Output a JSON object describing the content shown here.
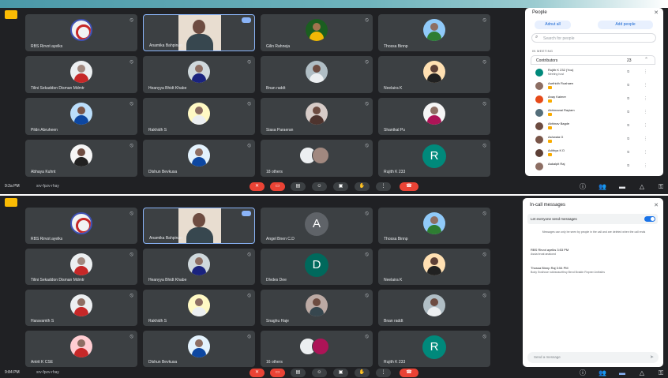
{
  "top": {
    "tiles": [
      {
        "name": "RBS Rirvot ayelks",
        "kind": "seal"
      },
      {
        "name": "Anamika Bahpinan",
        "kind": "video",
        "active": true
      },
      {
        "name": "Gilin Rahneja",
        "kind": "avatar",
        "skin": "#a1744e",
        "shirt": "#f2b705",
        "bg": "#1b5e20"
      },
      {
        "name": "Thossa Binnp",
        "kind": "avatar",
        "skin": "#8d6e63",
        "shirt": "#2e7d32",
        "bg": "#90caf9"
      },
      {
        "name": "Tilini Sekaddon Disman Mdmtr",
        "kind": "avatar",
        "skin": "#a1887f",
        "shirt": "#c62828",
        "bg": "#eceff1"
      },
      {
        "name": "Heanyya Bhidt Khabe",
        "kind": "avatar",
        "skin": "#8d6e63",
        "shirt": "#1a237e",
        "bg": "#cfd8dc"
      },
      {
        "name": "Bnan raddt",
        "kind": "avatar",
        "skin": "#6d4c41",
        "shirt": "#eceff1",
        "bg": "#b0bec5"
      },
      {
        "name": "Neelaira K",
        "kind": "avatar",
        "skin": "#5d4037",
        "shirt": "#212121",
        "bg": "#ffe0b2"
      },
      {
        "name": "Pildn Abruheen",
        "kind": "avatar",
        "skin": "#795548",
        "shirt": "#0d47a1",
        "bg": "#bbdefb"
      },
      {
        "name": "Rakhidh S",
        "kind": "avatar",
        "skin": "#8d6e63",
        "shirt": "#eceff1",
        "bg": "#fff9c4"
      },
      {
        "name": "Siasa Paraeran",
        "kind": "avatar",
        "skin": "#6d4c41",
        "shirt": "#4e342e",
        "bg": "#d7ccc8"
      },
      {
        "name": "Shantkal Pu",
        "kind": "avatar",
        "skin": "#8d6e63",
        "shirt": "#ad1457",
        "bg": "#f5f5f5"
      },
      {
        "name": "Abhaya Kuhnt",
        "kind": "avatar",
        "skin": "#6d4c41",
        "shirt": "#212121",
        "bg": "#f5f5f5"
      },
      {
        "name": "Dlshun Bevkusa",
        "kind": "avatar",
        "skin": "#8d6e63",
        "shirt": "#0d47a1",
        "bg": "#e3f2fd"
      },
      {
        "name": "18 others",
        "kind": "others",
        "c1": "#eceff1",
        "c2": "#a1887f"
      },
      {
        "name": "Rujith K 233",
        "kind": "letter",
        "letter": "R",
        "color": "#00897b"
      }
    ],
    "bar": {
      "time": "9:2a PM",
      "code": "srv-fpzv-rhay"
    },
    "people": {
      "title": "People",
      "add_label": "Adnut all",
      "add_people_label": "Add people",
      "search_placeholder": "Search for people",
      "section": "IN MEETING",
      "group_label": "Contributors",
      "group_count": "23",
      "rows": [
        {
          "name": "Rujith K 232 (You)",
          "sub": "Meeting host",
          "color": "#00897b",
          "tag": false
        },
        {
          "name": "Aarthidh Ruahaen",
          "sub": "",
          "color": "#8d6e63",
          "tag": true
        },
        {
          "name": "Anay Kaimer",
          "sub": "",
          "color": "#e64a19",
          "tag": true
        },
        {
          "name": "Abhimanai Rayiam",
          "sub": "",
          "color": "#546e7a",
          "tag": true
        },
        {
          "name": "Abhinav Bagde",
          "sub": "",
          "color": "#6d4c41",
          "tag": true
        },
        {
          "name": "Ashwala G",
          "sub": "",
          "color": "#795548",
          "tag": true
        },
        {
          "name": "Adithya K D",
          "sub": "",
          "color": "#5d4037",
          "tag": true
        },
        {
          "name": "Aakalpit Raj",
          "sub": "",
          "color": "#8d6e63",
          "tag": false
        }
      ]
    }
  },
  "bottom": {
    "tiles": [
      {
        "name": "RBS Rirvot ayelks",
        "kind": "seal"
      },
      {
        "name": "Anamika Bahpinan",
        "kind": "video",
        "active": true
      },
      {
        "name": "Angel Bnen C.D",
        "kind": "letter",
        "letter": "A",
        "color": "#5f6368"
      },
      {
        "name": "Thossa Binnp",
        "kind": "avatar",
        "skin": "#8d6e63",
        "shirt": "#2e7d32",
        "bg": "#90caf9"
      },
      {
        "name": "Tilini Sekaddon Disman Mdmtr",
        "kind": "avatar",
        "skin": "#a1887f",
        "shirt": "#c62828",
        "bg": "#eceff1"
      },
      {
        "name": "Heanyya Bhidt Khabe",
        "kind": "avatar",
        "skin": "#8d6e63",
        "shirt": "#1a237e",
        "bg": "#cfd8dc"
      },
      {
        "name": "Dlvdes Dee",
        "kind": "letter",
        "letter": "D",
        "color": "#00695c"
      },
      {
        "name": "Neelaira K",
        "kind": "avatar",
        "skin": "#5d4037",
        "shirt": "#212121",
        "bg": "#ffe0b2"
      },
      {
        "name": "Haravamth S",
        "kind": "avatar",
        "skin": "#8d6e63",
        "shirt": "#c62828",
        "bg": "#eceff1"
      },
      {
        "name": "Rakhidh S",
        "kind": "avatar",
        "skin": "#8d6e63",
        "shirt": "#eceff1",
        "bg": "#fff9c4"
      },
      {
        "name": "Snaghu Haje",
        "kind": "avatar",
        "skin": "#6d4c41",
        "shirt": "#37474f",
        "bg": "#bcaaa4"
      },
      {
        "name": "Bnan raddt",
        "kind": "avatar",
        "skin": "#6d4c41",
        "shirt": "#eceff1",
        "bg": "#b0bec5"
      },
      {
        "name": "Antrit K CSE",
        "kind": "avatar",
        "skin": "#8d6e63",
        "shirt": "#c62828",
        "bg": "#ffcdd2"
      },
      {
        "name": "Dlshun Bevkusa",
        "kind": "avatar",
        "skin": "#8d6e63",
        "shirt": "#0d47a1",
        "bg": "#e3f2fd"
      },
      {
        "name": "16 others",
        "kind": "others",
        "c1": "#eceff1",
        "c2": "#ad1457"
      },
      {
        "name": "Rujith K 233",
        "kind": "letter",
        "letter": "R",
        "color": "#00897b"
      }
    ],
    "bar": {
      "time": "9:84 PM",
      "code": "srv-fpzv-rhay"
    },
    "chat": {
      "title": "In-call messages",
      "toggle_label": "Let everyone send messages",
      "notice": "Messages can only be seen by people in the call and are deleted when the call ends",
      "messages": [
        {
          "who": "RBS Rirvot ayelks  3:53 PM",
          "text": "Assia broat anakond"
        },
        {
          "who": "Thossa Binnp Raj  3:54 PM",
          "text": "Body Svsihcse rukbsnaurithsy Bevd Bvaldn Rnpner Anthsihs"
        }
      ],
      "placeholder": "Send a message"
    }
  },
  "colors": {
    "bg": "#202124",
    "tile": "#3c4043",
    "accent": "#8ab4f8",
    "end": "#ea4335"
  }
}
